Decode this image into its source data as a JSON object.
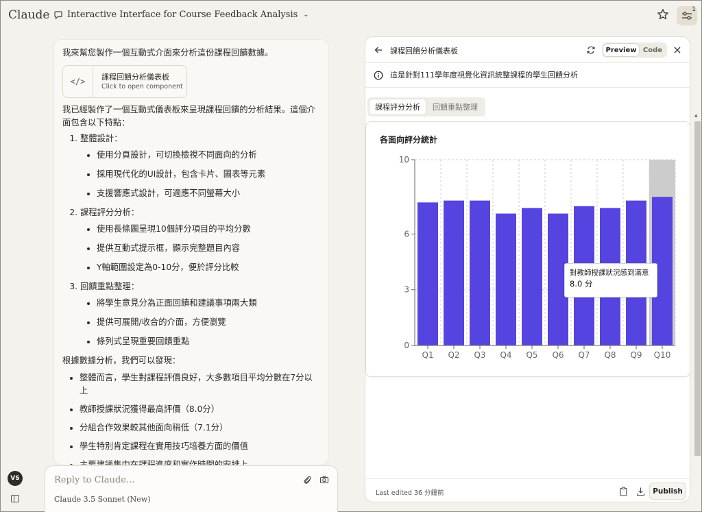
{
  "app": {
    "brand": "Claude"
  },
  "header": {
    "chat_title": "Interactive Interface for Course Feedback Analysis",
    "settings_badge": "1"
  },
  "chat": {
    "intro": "我來幫您製作一個互動式介面來分析這份課程回饋數據。",
    "artifact_card": {
      "title": "課程回饋分析儀表板",
      "subtitle": "Click to open component",
      "icon": "</>"
    },
    "summary": "我已經製作了一個互動式儀表板來呈現課程回饋的分析結果。這個介面包含以下特點：",
    "sections": [
      {
        "title": "整體設計：",
        "items": [
          "使用分頁設計，可切換檢視不同面向的分析",
          "採用現代化的UI設計，包含卡片、圖表等元素",
          "支援響應式設計，可適應不同螢幕大小"
        ]
      },
      {
        "title": "課程評分分析：",
        "items": [
          "使用長條圖呈現10個評分項目的平均分數",
          "提供互動式提示框，顯示完整題目內容",
          "Y軸範圍設定為0-10分，便於評分比較"
        ]
      },
      {
        "title": "回饋重點整理：",
        "items": [
          "將學生意見分為正面回饋和建議事項兩大類",
          "提供可展開/收合的介面，方便瀏覽",
          "條列式呈現重要回饋重點"
        ]
      }
    ],
    "findings_intro": "根據數據分析，我們可以發現：",
    "findings": [
      "整體而言，學生對課程評價良好，大多數項目平均分數在7分以上",
      "教師授課狀況獲得最高評價（8.0分）",
      "分組合作效果較其他面向稍低（7.1分）",
      "學生特別肯定課程在實用技巧培養方面的價值",
      "主要建議集中在課程進度和實作時間的安排上"
    ]
  },
  "user": {
    "initials": "VS"
  },
  "input": {
    "placeholder": "Reply to Claude...",
    "model": "Claude 3.5 Sonnet (New)"
  },
  "artifact": {
    "title": "課程回饋分析儀表板",
    "toggle": {
      "preview": "Preview",
      "code": "Code"
    },
    "info": "這是針對111學年度視覺化資訊統整課程的學生回饋分析",
    "tabs": [
      "課程評分分析",
      "回饋重點整理"
    ],
    "footer": {
      "edited": "Last edited 36 分鐘前",
      "publish": "Publish"
    }
  },
  "chart_data": {
    "type": "bar",
    "title": "各面向評分統計",
    "categories": [
      "Q1",
      "Q2",
      "Q3",
      "Q4",
      "Q5",
      "Q6",
      "Q7",
      "Q8",
      "Q9",
      "Q10"
    ],
    "values": [
      7.7,
      7.8,
      7.8,
      7.1,
      7.4,
      7.1,
      7.5,
      7.4,
      7.8,
      8.0
    ],
    "ylim": [
      0,
      10
    ],
    "yticks": [
      0,
      3,
      6,
      10
    ],
    "grid": true,
    "bar_color": "#5544e0",
    "highlight_color": "#cccccc",
    "highlighted_index": 9,
    "tooltip": {
      "label": "對教師授課狀況感到滿意",
      "value": "8.0 分"
    }
  }
}
